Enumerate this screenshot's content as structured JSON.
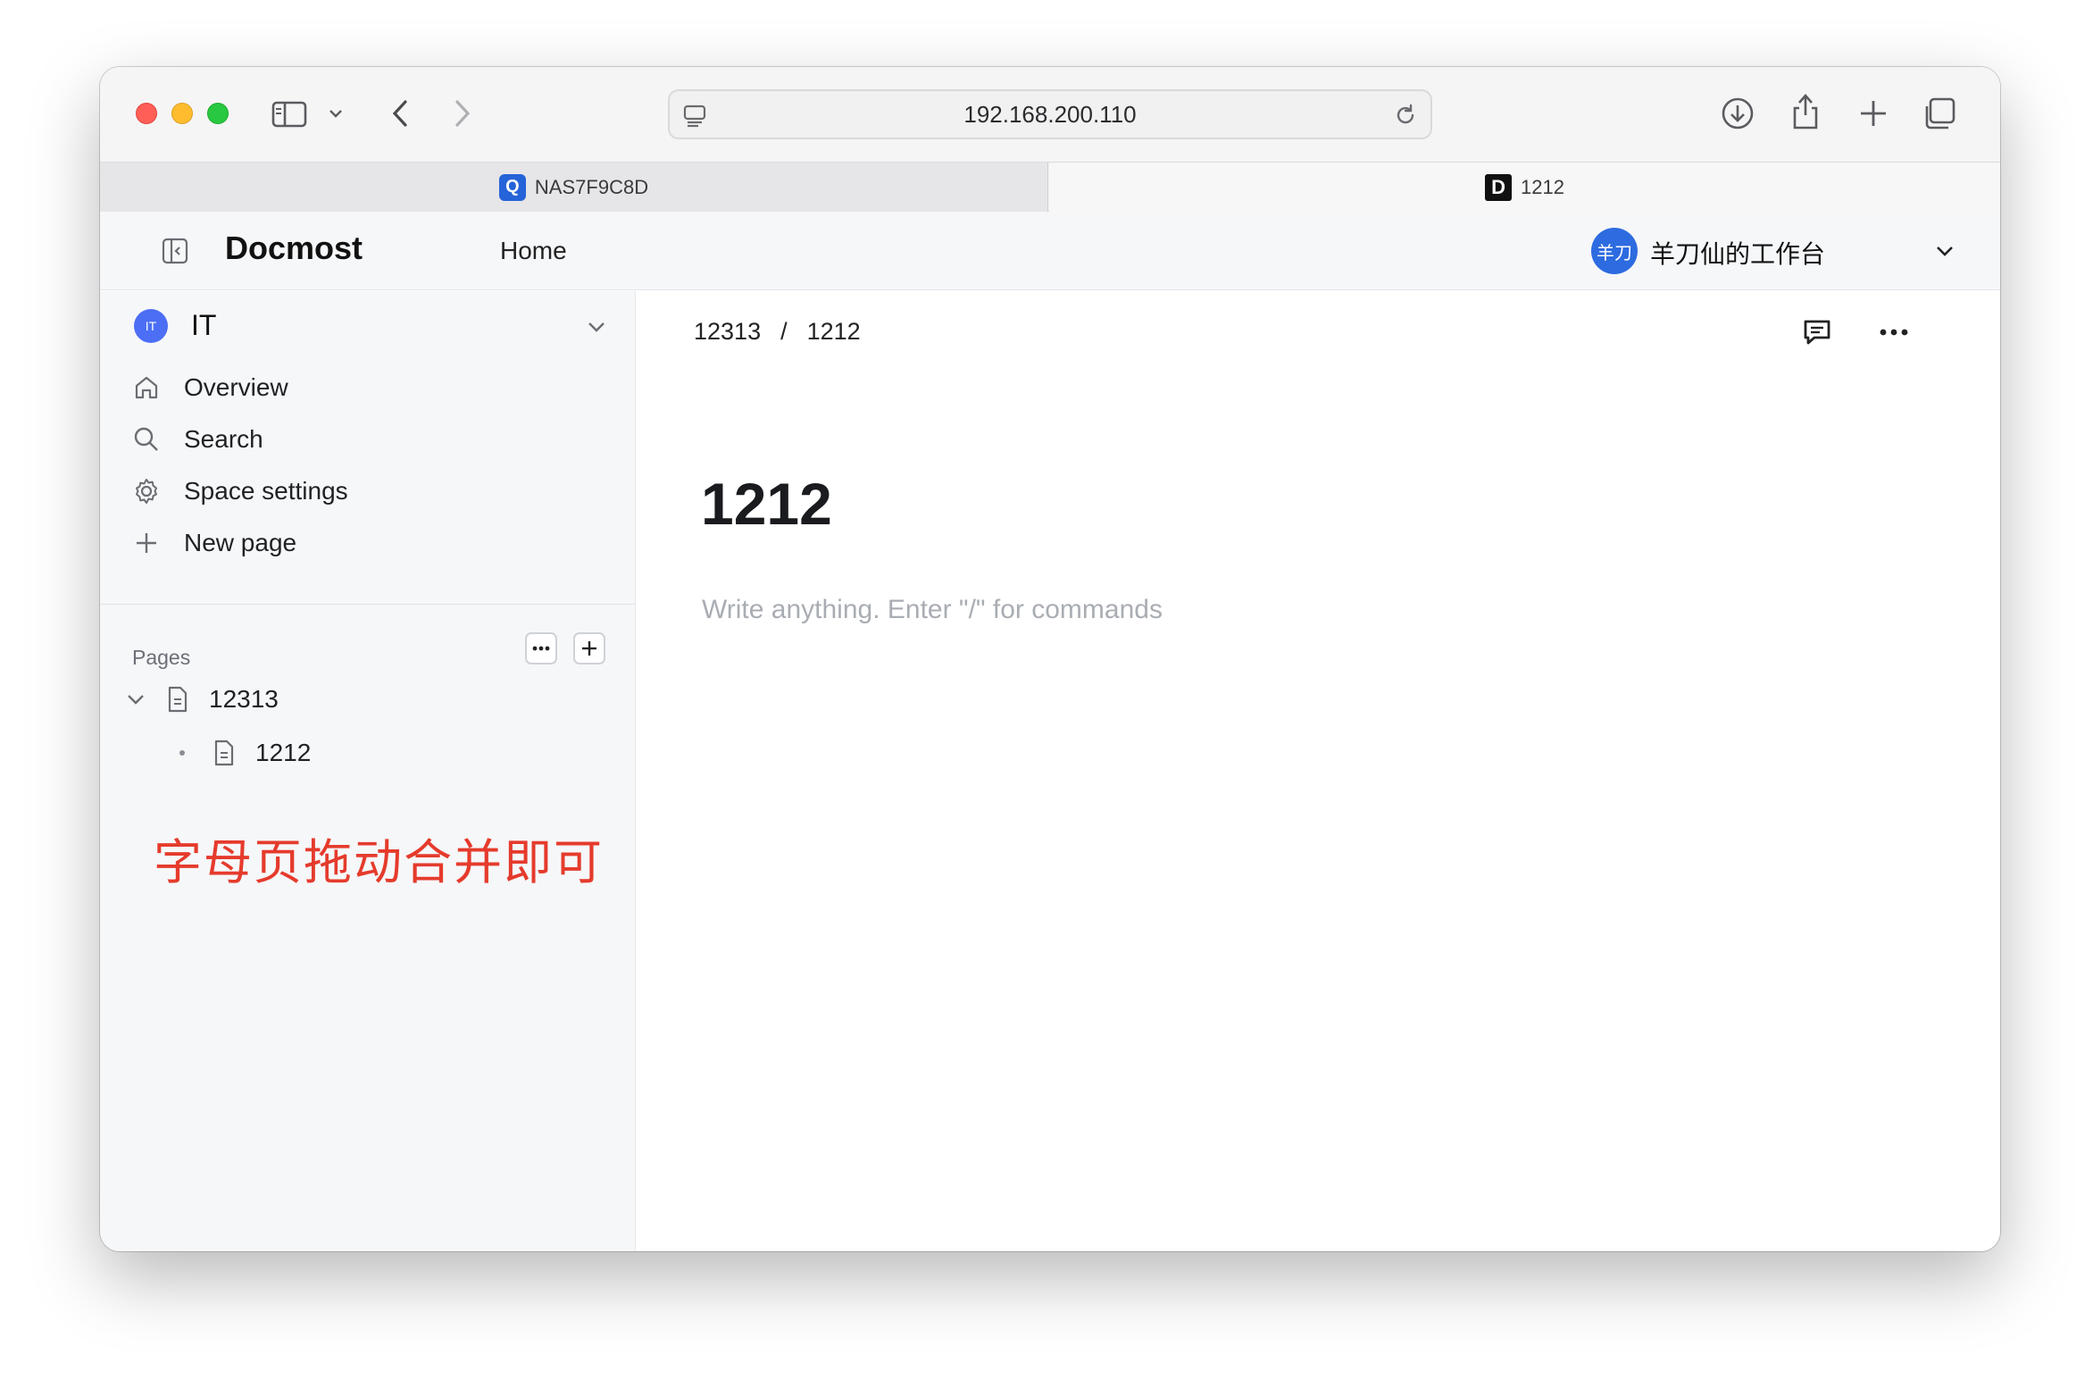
{
  "browser": {
    "url": "192.168.200.110",
    "tabs": [
      {
        "label": "NAS7F9C8D",
        "favicon": "qnap-icon",
        "active": false
      },
      {
        "label": "1212",
        "favicon": "docmost-d-icon",
        "active": true
      }
    ],
    "favicon_d_letter": "D",
    "favicon_q_letter": "Q"
  },
  "header": {
    "brand": "Docmost",
    "home_link": "Home",
    "workspace_avatar": "羊刀",
    "workspace_name": "羊刀仙的工作台",
    "accent_color": "#2d6be0"
  },
  "sidebar": {
    "space_avatar": "IT",
    "space_name": "IT",
    "nav": [
      {
        "label": "Overview",
        "icon": "home-icon"
      },
      {
        "label": "Search",
        "icon": "search-icon"
      },
      {
        "label": "Space settings",
        "icon": "gear-icon"
      },
      {
        "label": "New page",
        "icon": "plus-icon"
      }
    ],
    "pages_label": "Pages",
    "tree": [
      {
        "label": "12313",
        "expanded": true,
        "children": [
          {
            "label": "1212"
          }
        ]
      }
    ],
    "annotation": "字母页拖动合并即可",
    "annotation_color": "#e53b2c"
  },
  "main": {
    "breadcrumb": [
      "12313",
      "/",
      "1212"
    ],
    "title": "1212",
    "placeholder": "Write anything. Enter \"/\" for commands"
  }
}
